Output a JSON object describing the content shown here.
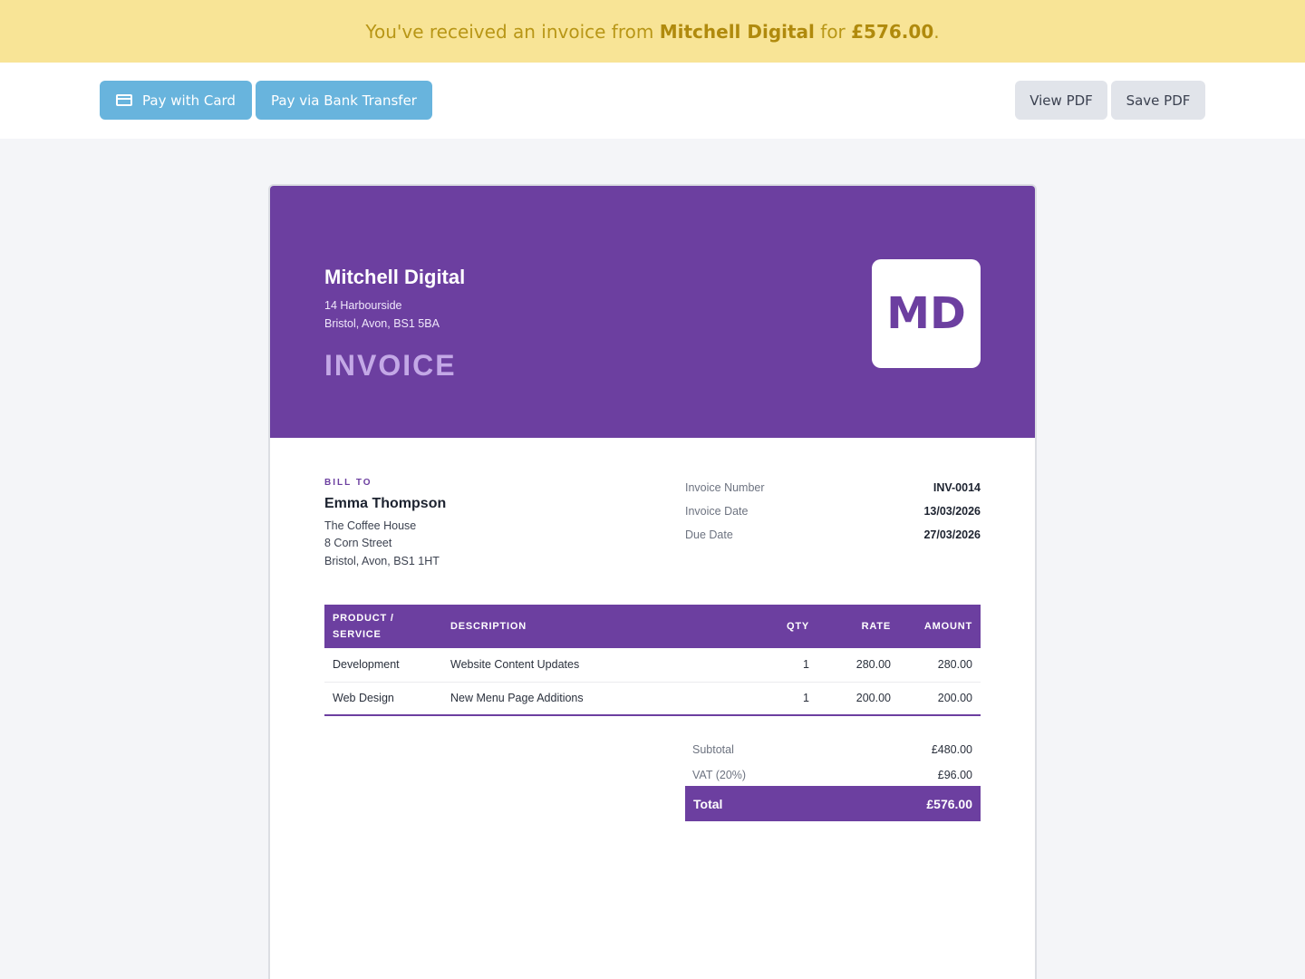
{
  "banner": {
    "prefix": "You've received an invoice from ",
    "company": "Mitchell Digital",
    "middle": " for ",
    "amount": "£576.00",
    "suffix": "."
  },
  "toolbar": {
    "pay_card_label": "Pay with Card",
    "pay_card_icon": "credit-card-icon",
    "pay_bank_label": "Pay via Bank Transfer",
    "view_pdf_label": "View PDF",
    "save_pdf_label": "Save PDF"
  },
  "invoice": {
    "company_name": "Mitchell Digital",
    "company_address": [
      "14 Harbourside",
      "Bristol, Avon, BS1 5BA"
    ],
    "title": "INVOICE",
    "logo_text": "MD",
    "bill_to_label": "BILL TO",
    "client_name": "Emma Thompson",
    "client_address": [
      "The Coffee House",
      "8 Corn Street",
      "Bristol, Avon, BS1 1HT"
    ],
    "meta": [
      {
        "label": "Invoice Number",
        "value": "INV-0014"
      },
      {
        "label": "Invoice Date",
        "value": "13/03/2026"
      },
      {
        "label": "Due Date",
        "value": "27/03/2026"
      }
    ],
    "columns": {
      "product_line1": "PRODUCT /",
      "product_line2": "SERVICE",
      "description": "DESCRIPTION",
      "qty": "QTY",
      "rate": "RATE",
      "amount": "AMOUNT"
    },
    "items": [
      {
        "product": "Development",
        "description": "Website Content Updates",
        "qty": "1",
        "rate": "280.00",
        "amount": "280.00"
      },
      {
        "product": "Web Design",
        "description": "New Menu Page Additions",
        "qty": "1",
        "rate": "200.00",
        "amount": "200.00"
      }
    ],
    "subtotal_label": "Subtotal",
    "subtotal": "£480.00",
    "vat_label": "VAT (20%)",
    "vat": "£96.00",
    "total_label": "Total",
    "total": "£576.00"
  },
  "colors": {
    "banner_bg": "#f8e496",
    "accent_purple": "#6c3fa0",
    "pay_button": "#68b4dd",
    "secondary_button": "#e1e4ea"
  }
}
